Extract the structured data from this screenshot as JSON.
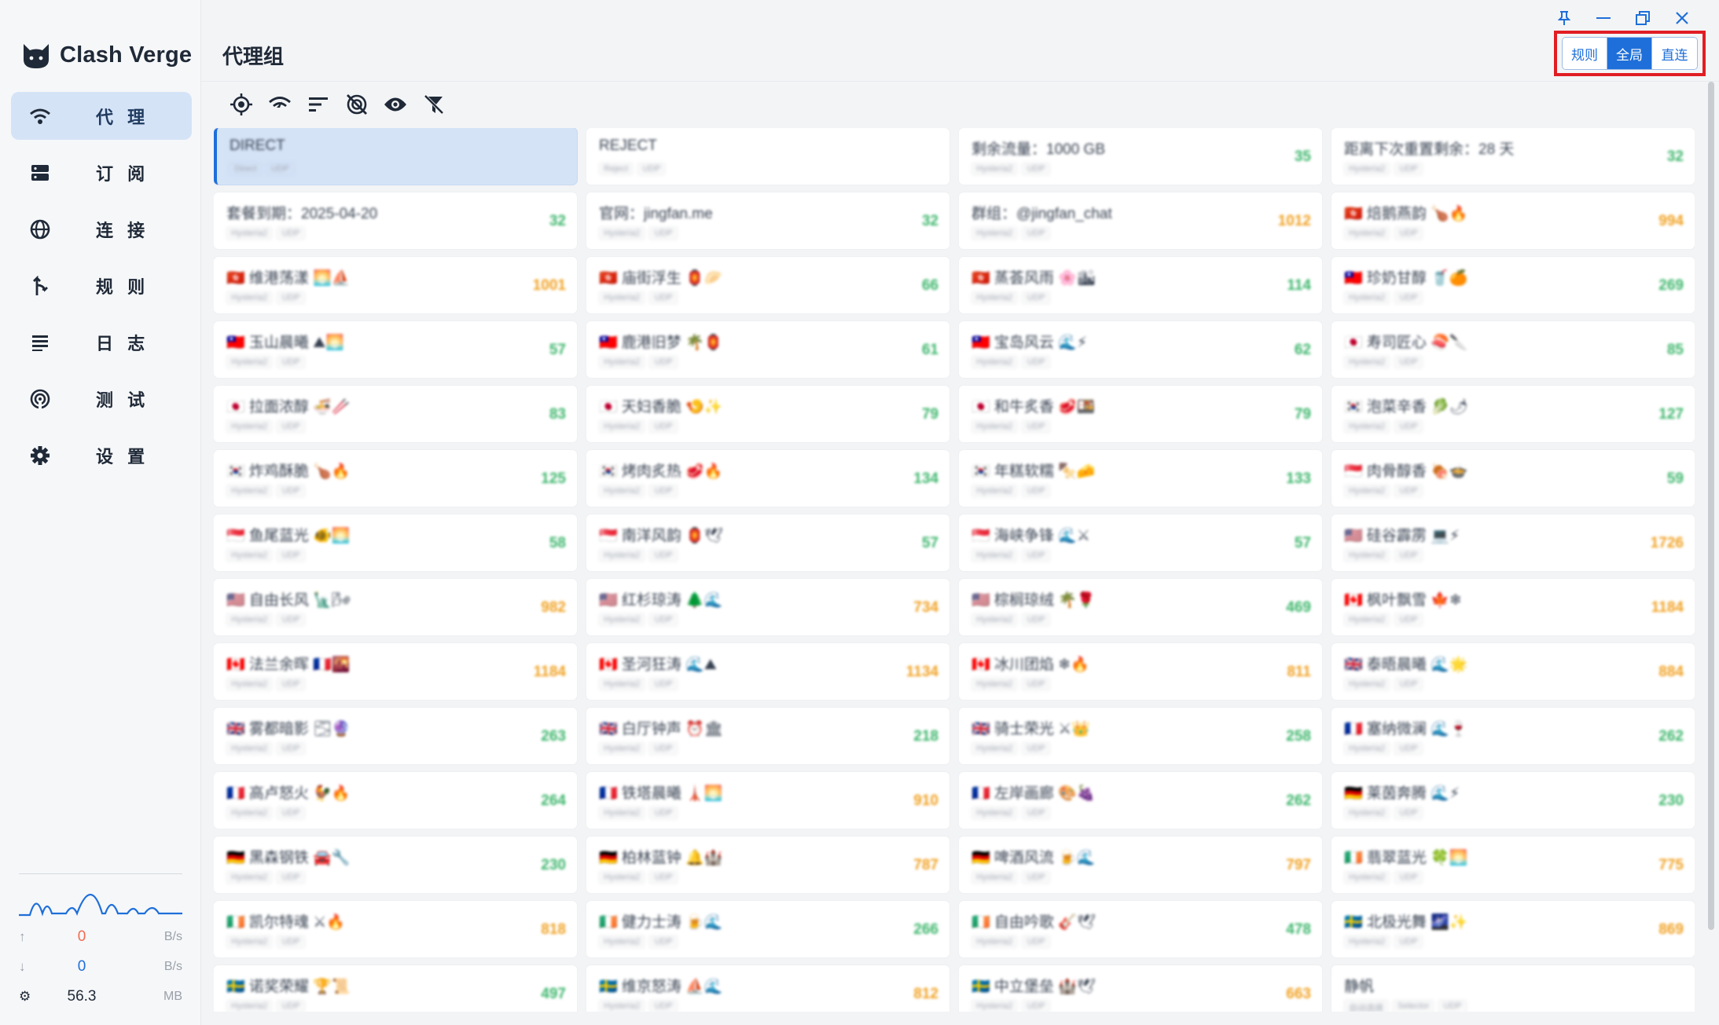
{
  "app": {
    "name": "Clash Verge"
  },
  "sidebar": {
    "items": [
      {
        "label": "代 理",
        "icon": "wifi-icon",
        "active": true
      },
      {
        "label": "订 阅",
        "icon": "storage-icon",
        "active": false
      },
      {
        "label": "连 接",
        "icon": "globe-icon",
        "active": false
      },
      {
        "label": "规 则",
        "icon": "fork-icon",
        "active": false
      },
      {
        "label": "日 志",
        "icon": "lines-icon",
        "active": false
      },
      {
        "label": "测 试",
        "icon": "radar-icon",
        "active": false
      },
      {
        "label": "设 置",
        "icon": "gear-icon",
        "active": false
      }
    ]
  },
  "traffic": {
    "up": {
      "value": "0",
      "unit": "B/s"
    },
    "down": {
      "value": "0",
      "unit": "B/s"
    },
    "memory": {
      "value": "56.3",
      "unit": "MB"
    }
  },
  "header": {
    "title": "代理组"
  },
  "mode": {
    "options": [
      "规则",
      "全局",
      "直连"
    ],
    "selected": "全局"
  },
  "toolbar": [
    "locate-icon",
    "speedtest-icon",
    "sort-icon",
    "hide-unavailable-icon",
    "show-icon",
    "filter-off-icon"
  ],
  "proxies": [
    {
      "name": "DIRECT",
      "tags": [
        "Direct",
        "UDP"
      ],
      "delay": "",
      "selected": true
    },
    {
      "name": "REJECT",
      "tags": [
        "Reject",
        "UDP"
      ],
      "delay": ""
    },
    {
      "name": "剩余流量：1000 GB",
      "tags": [
        "Hysteria2",
        "UDP"
      ],
      "delay": "35",
      "color": "green"
    },
    {
      "name": "距离下次重置剩余：28 天",
      "tags": [
        "Hysteria2",
        "UDP"
      ],
      "delay": "32",
      "color": "green"
    },
    {
      "name": "套餐到期：2025-04-20",
      "tags": [
        "Hysteria2",
        "UDP"
      ],
      "delay": "32",
      "color": "green"
    },
    {
      "name": "官网：jingfan.me",
      "tags": [
        "Hysteria2",
        "UDP"
      ],
      "delay": "32",
      "color": "green"
    },
    {
      "name": "群组：@jingfan_chat",
      "tags": [
        "Hysteria2",
        "UDP"
      ],
      "delay": "1012",
      "color": "orange"
    },
    {
      "name": "🇭🇰 焙鹅燕韵 🍗🔥",
      "tags": [
        "Hysteria2",
        "UDP"
      ],
      "delay": "994",
      "color": "orange"
    },
    {
      "name": "🇭🇰 维港荡漾 🌅⛵",
      "tags": [
        "Hysteria2",
        "UDP"
      ],
      "delay": "1001",
      "color": "orange"
    },
    {
      "name": "🇭🇰 庙街浮生 🏮🥟",
      "tags": [
        "Hysteria2",
        "UDP"
      ],
      "delay": "66",
      "color": "green"
    },
    {
      "name": "🇭🇰 蒸荟风雨 🌸🏙",
      "tags": [
        "Hysteria2",
        "UDP"
      ],
      "delay": "114",
      "color": "green"
    },
    {
      "name": "🇹🇼 珍奶甘醇 🥤🍊",
      "tags": [
        "Hysteria2",
        "UDP"
      ],
      "delay": "269",
      "color": "green"
    },
    {
      "name": "🇹🇼 玉山晨曦 ⛰🌅",
      "tags": [
        "Hysteria2",
        "UDP"
      ],
      "delay": "57",
      "color": "green"
    },
    {
      "name": "🇹🇼 鹿港旧梦 🌴🏮",
      "tags": [
        "Hysteria2",
        "UDP"
      ],
      "delay": "61",
      "color": "green"
    },
    {
      "name": "🇹🇼 宝岛风云 🌊⚡",
      "tags": [
        "Hysteria2",
        "UDP"
      ],
      "delay": "62",
      "color": "green"
    },
    {
      "name": "🇯🇵 寿司匠心 🍣🔪",
      "tags": [
        "Hysteria2",
        "UDP"
      ],
      "delay": "85",
      "color": "green"
    },
    {
      "name": "🇯🇵 拉面浓醇 🍜🥢",
      "tags": [
        "Hysteria2",
        "UDP"
      ],
      "delay": "83",
      "color": "green"
    },
    {
      "name": "🇯🇵 天妇香脆 🍤✨",
      "tags": [
        "Hysteria2",
        "UDP"
      ],
      "delay": "79",
      "color": "green"
    },
    {
      "name": "🇯🇵 和牛炙香 🥩🍱",
      "tags": [
        "Hysteria2",
        "UDP"
      ],
      "delay": "79",
      "color": "green"
    },
    {
      "name": "🇰🇷 泡菜辛香 🥬🌶",
      "tags": [
        "Hysteria2",
        "UDP"
      ],
      "delay": "127",
      "color": "green"
    },
    {
      "name": "🇰🇷 炸鸡酥脆 🍗🔥",
      "tags": [
        "Hysteria2",
        "UDP"
      ],
      "delay": "125",
      "color": "green"
    },
    {
      "name": "🇰🇷 烤肉炙热 🥩🔥",
      "tags": [
        "Hysteria2",
        "UDP"
      ],
      "delay": "134",
      "color": "green"
    },
    {
      "name": "🇰🇷 年糕软糯 🍢🧀",
      "tags": [
        "Hysteria2",
        "UDP"
      ],
      "delay": "133",
      "color": "green"
    },
    {
      "name": "🇸🇬 肉骨醇香 🍖🍲",
      "tags": [
        "Hysteria2",
        "UDP"
      ],
      "delay": "59",
      "color": "green"
    },
    {
      "name": "🇸🇬 鱼尾蓝光 🐠🌅",
      "tags": [
        "Hysteria2",
        "UDP"
      ],
      "delay": "58",
      "color": "green"
    },
    {
      "name": "🇸🇬 南洋风韵 🏮🕊",
      "tags": [
        "Hysteria2",
        "UDP"
      ],
      "delay": "57",
      "color": "green"
    },
    {
      "name": "🇸🇬 海峡争锋 🌊⚔",
      "tags": [
        "Hysteria2",
        "UDP"
      ],
      "delay": "57",
      "color": "green"
    },
    {
      "name": "🇺🇸 硅谷霹雳 💻⚡",
      "tags": [
        "Hysteria2",
        "UDP"
      ],
      "delay": "1726",
      "color": "orange"
    },
    {
      "name": "🇺🇸 自由长风 🗽🌬",
      "tags": [
        "Hysteria2",
        "UDP"
      ],
      "delay": "982",
      "color": "orange"
    },
    {
      "name": "🇺🇸 红杉琼涛 🌲🌊",
      "tags": [
        "Hysteria2",
        "UDP"
      ],
      "delay": "734",
      "color": "orange"
    },
    {
      "name": "🇺🇸 棕榈琼绒 🌴🌹",
      "tags": [
        "Hysteria2",
        "UDP"
      ],
      "delay": "469",
      "color": "green"
    },
    {
      "name": "🇨🇦 枫叶飘雪 🍁❄",
      "tags": [
        "Hysteria2",
        "UDP"
      ],
      "delay": "1184",
      "color": "orange"
    },
    {
      "name": "🇨🇦 法兰余晖 🇫🇷🌇",
      "tags": [
        "Hysteria2",
        "UDP"
      ],
      "delay": "1184",
      "color": "orange"
    },
    {
      "name": "🇨🇦 圣河狂涛 🌊⛰",
      "tags": [
        "Hysteria2",
        "UDP"
      ],
      "delay": "1134",
      "color": "orange"
    },
    {
      "name": "🇨🇦 冰川团焰 ❄🔥",
      "tags": [
        "Hysteria2",
        "UDP"
      ],
      "delay": "811",
      "color": "orange"
    },
    {
      "name": "🇬🇧 泰晤晨曦 🌊🌟",
      "tags": [
        "Hysteria2",
        "UDP"
      ],
      "delay": "884",
      "color": "orange"
    },
    {
      "name": "🇬🇧 雾都暗影 🌫🔮",
      "tags": [
        "Hysteria2",
        "UDP"
      ],
      "delay": "263",
      "color": "green"
    },
    {
      "name": "🇬🇧 白厅钟声 ⏰🏛",
      "tags": [
        "Hysteria2",
        "UDP"
      ],
      "delay": "218",
      "color": "green"
    },
    {
      "name": "🇬🇧 骑士荣光 ⚔👑",
      "tags": [
        "Hysteria2",
        "UDP"
      ],
      "delay": "258",
      "color": "green"
    },
    {
      "name": "🇫🇷 塞纳微澜 🌊🍷",
      "tags": [
        "Hysteria2",
        "UDP"
      ],
      "delay": "262",
      "color": "green"
    },
    {
      "name": "🇫🇷 高卢怒火 🐓🔥",
      "tags": [
        "Hysteria2",
        "UDP"
      ],
      "delay": "264",
      "color": "green"
    },
    {
      "name": "🇫🇷 铁塔晨曦 🗼🌅",
      "tags": [
        "Hysteria2",
        "UDP"
      ],
      "delay": "910",
      "color": "orange"
    },
    {
      "name": "🇫🇷 左岸画廊 🎨🍇",
      "tags": [
        "Hysteria2",
        "UDP"
      ],
      "delay": "262",
      "color": "green"
    },
    {
      "name": "🇩🇪 莱茵奔腾 🌊⚡",
      "tags": [
        "Hysteria2",
        "UDP"
      ],
      "delay": "230",
      "color": "green"
    },
    {
      "name": "🇩🇪 黑森钢铁 🚘🔧",
      "tags": [
        "Hysteria2",
        "UDP"
      ],
      "delay": "230",
      "color": "green"
    },
    {
      "name": "🇩🇪 柏林蓝钟 🔔🏰",
      "tags": [
        "Hysteria2",
        "UDP"
      ],
      "delay": "787",
      "color": "orange"
    },
    {
      "name": "🇩🇪 啤酒风流 🍺🌊",
      "tags": [
        "Hysteria2",
        "UDP"
      ],
      "delay": "797",
      "color": "orange"
    },
    {
      "name": "🇮🇪 翡翠蓝光 🍀🌅",
      "tags": [
        "Hysteria2",
        "UDP"
      ],
      "delay": "775",
      "color": "orange"
    },
    {
      "name": "🇮🇪 凯尔特魂 ⚔🔥",
      "tags": [
        "Hysteria2",
        "UDP"
      ],
      "delay": "818",
      "color": "orange"
    },
    {
      "name": "🇮🇪 健力士涛 🍺🌊",
      "tags": [
        "Hysteria2",
        "UDP"
      ],
      "delay": "266",
      "color": "green"
    },
    {
      "name": "🇮🇪 自由吟歌 🎸🕊",
      "tags": [
        "Hysteria2",
        "UDP"
      ],
      "delay": "478",
      "color": "green"
    },
    {
      "name": "🇸🇪 北极光舞 🌌✨",
      "tags": [
        "Hysteria2",
        "UDP"
      ],
      "delay": "869",
      "color": "orange"
    },
    {
      "name": "🇸🇪 诺奖荣耀 🏆📜",
      "tags": [
        "Hysteria2",
        "UDP"
      ],
      "delay": "497",
      "color": "green"
    },
    {
      "name": "🇸🇪 维京怒涛 ⛵🌊",
      "tags": [
        "Hysteria2",
        "UDP"
      ],
      "delay": "812",
      "color": "orange"
    },
    {
      "name": "🇸🇪 中立堡垒 🏰🕊",
      "tags": [
        "Hysteria2",
        "UDP"
      ],
      "delay": "663",
      "color": "orange"
    },
    {
      "name": "静帆",
      "tags": [
        "自动选择",
        "Selector",
        "UDP"
      ],
      "delay": ""
    }
  ]
}
